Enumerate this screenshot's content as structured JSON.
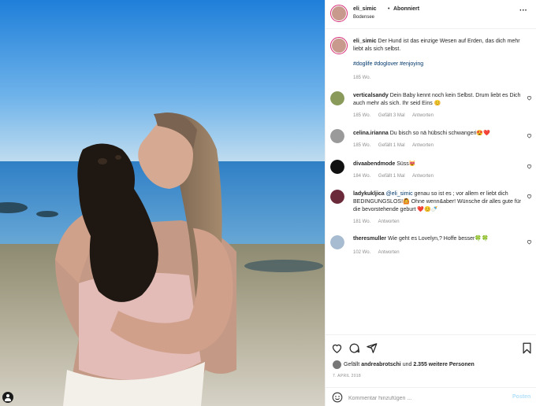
{
  "header": {
    "username": "eli_simic",
    "separator": "•",
    "follow_status": "Abonniert",
    "location": "Bodensee",
    "more_icon": "more-horizontal-icon"
  },
  "caption": {
    "username": "eli_simic",
    "text": "Der Hund ist das einzige Wesen auf Erden, das dich mehr liebt als sich selbst.",
    "hashtags": "#doglife #doglover #enjoying",
    "time": "185 Wo."
  },
  "comments": [
    {
      "username": "verticalsandy",
      "text": "Dein Baby kennt noch kein Selbst. Drum liebt es Dich auch mehr als sich. Ihr seid Eins 😊",
      "time": "185 Wo.",
      "likes": "Gefällt 3 Mal",
      "reply": "Antworten",
      "avatar_color": "#8a9a5b"
    },
    {
      "username": "celina.irianna",
      "text": "Du bisch so nä hübschi schwangeri😍❤️",
      "time": "185 Wo.",
      "likes": "Gefällt 1 Mal",
      "reply": "Antworten",
      "avatar_color": "#9a9a9a"
    },
    {
      "username": "divaabendmode",
      "text": "Süss😻",
      "time": "184 Wo.",
      "likes": "Gefällt 1 Mal",
      "reply": "Antworten",
      "avatar_color": "#111111"
    },
    {
      "username": "ladykukljica",
      "mention": "@eli_simic",
      "text": " genau so ist es ; vor allem er liebt dich BEDINGUNGSLOS!🙆 Ohne wenn&aber! Wünsche dir alles gute für die bevorstehende geburt ❤️😊🍼",
      "time": "181 Wo.",
      "reply": "Antworten",
      "avatar_color": "#6b2a3a"
    },
    {
      "username": "theresmuller",
      "text": "Wie geht es Lovelyn,? Hoffe besser🍀🍀",
      "time": "102 Wo.",
      "reply": "Antworten",
      "avatar_color": "#a7bcd0"
    }
  ],
  "actions": {
    "like_icon": "heart-icon",
    "comment_icon": "comment-icon",
    "share_icon": "send-icon",
    "save_icon": "bookmark-icon"
  },
  "likes": {
    "prefix": "Gefällt ",
    "user": "andreabrotschi",
    "middle": " und ",
    "others": "2.355 weitere Personen"
  },
  "date": "7. APRIL 2018",
  "comment_box": {
    "placeholder": "Kommentar hinzufügen ...",
    "post_label": "Posten",
    "icon": "smiley-icon"
  },
  "colors": {
    "link": "#00376b",
    "meta": "#8e8e8e",
    "post_button": "#b2dffc",
    "story_ring": "#d62976"
  }
}
